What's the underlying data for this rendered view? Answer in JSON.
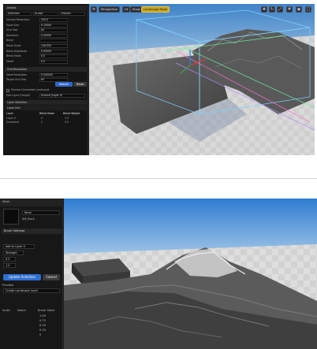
{
  "top": {
    "panel": {
      "header": "Details",
      "tabs": [
        "Selection",
        "Sculpt",
        "Erosion"
      ],
      "rows": [
        {
          "label": "Volume Resolution",
          "value": "100.0"
        },
        {
          "label": "Voxel Size",
          "value": "0.10000"
        },
        {
          "label": "Grid Size",
          "value": "64"
        },
        {
          "label": "Iterations",
          "value": "0.00000"
        },
        {
          "label": "Noise",
          "value": ""
        },
        {
          "label": "Noise Scale",
          "value": "128.000"
        },
        {
          "label": "Noise Amplitude",
          "value": "0.00000"
        },
        {
          "label": "Blend Mode",
          "value": "0.0"
        },
        {
          "label": "Falloff",
          "value": "0.0"
        }
      ],
      "section2": "Grid Resolution",
      "rows2": [
        {
          "label": "Voxel Resolution",
          "value": "0.000000"
        },
        {
          "label": "Target Grid Size",
          "value": "64"
        }
      ],
      "buttons": {
        "primary": "Rebuild",
        "secondary": "Reset"
      },
      "checkbox": "Preview Generated Landscape",
      "dropdown_label": "Edit Layer (Height)",
      "dropdown_value": "Ground (Layer 0)",
      "section3": "Layer Selection",
      "section4": "Layer Info",
      "table_headers": [
        "Layer",
        "Blend Mode",
        "Blend Weight"
      ],
      "table_rows": [
        [
          "Layer 0",
          "0",
          "1.0"
        ],
        [
          "Grassland",
          "2",
          "0.5"
        ]
      ]
    },
    "toolbar": {
      "mode": "Perspective",
      "lit": "Lit",
      "show": "Show",
      "selected": "Landscape Mode"
    }
  },
  "bottom": {
    "panel": {
      "slot_label": "Mesh",
      "asset_value": "None",
      "asset_sub": "SM_Rock",
      "section": "Brush Settings",
      "dropdown_a": "Add to Layer 0",
      "dropdown_b": "Strength",
      "field_a": "0.5",
      "field_b": "1.0",
      "apply_button": "Update Selection",
      "cancel_button": "Cancel",
      "preview_label": "Preview",
      "preview_value": "Create Landscape Layer",
      "columns": [
        "Index",
        "Name",
        "Brush Value"
      ],
      "values": [
        "1.00",
        "0.75",
        "0.50",
        "0.25",
        "0"
      ]
    }
  }
}
